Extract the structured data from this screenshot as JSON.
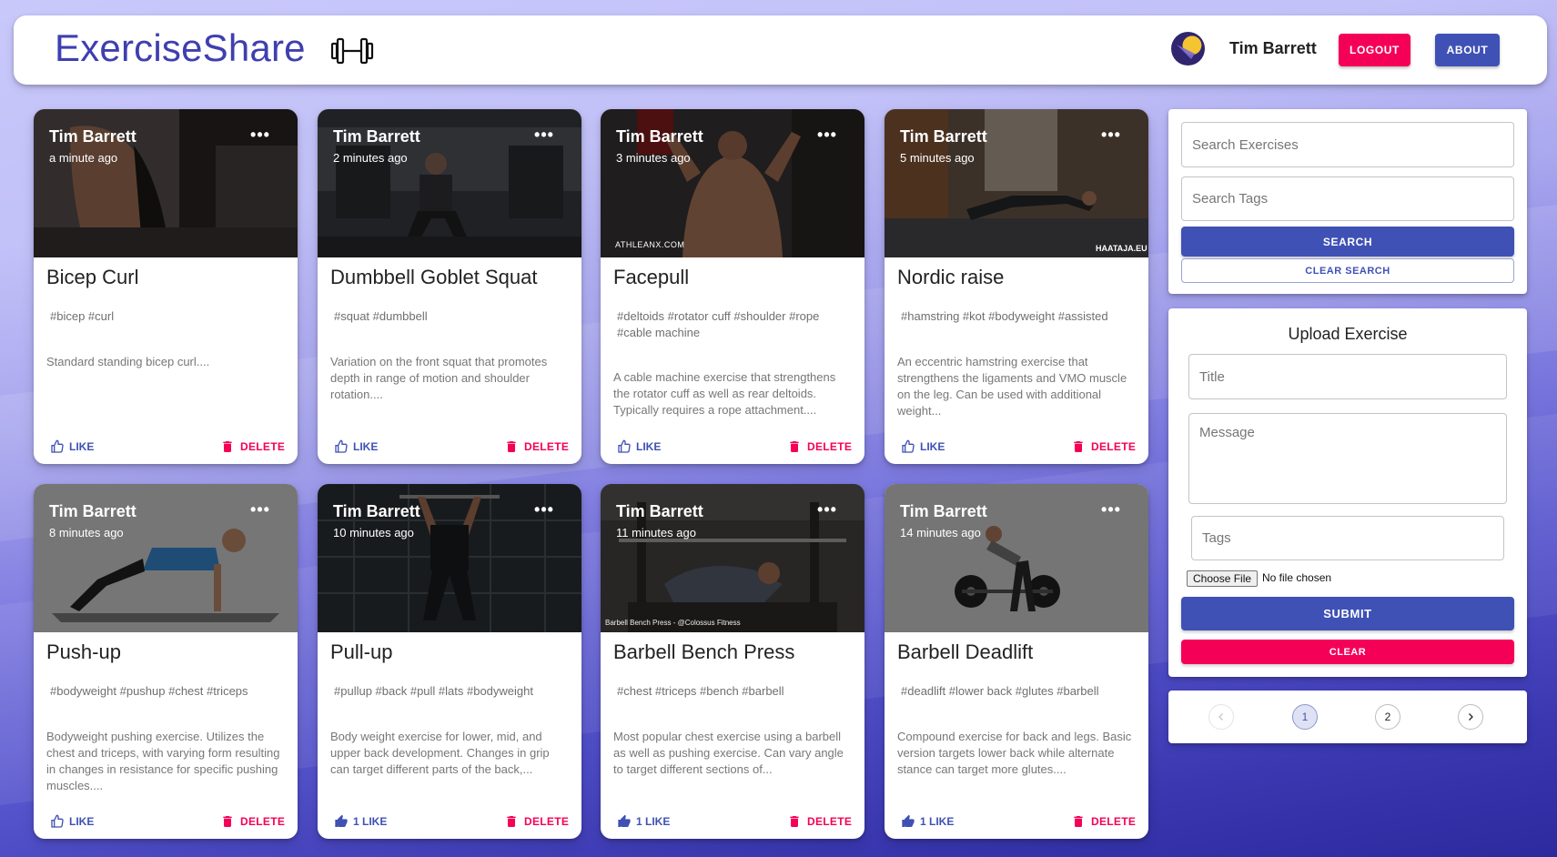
{
  "header": {
    "brand": "ExerciseShare",
    "brand_icon": "dumbbell-icon",
    "user_name": "Tim Barrett",
    "logout_label": "LOGOUT",
    "about_label": "ABOUT"
  },
  "colors": {
    "primary": "#3f51b5",
    "secondary": "#f50057",
    "brand_text": "#3f3fb0"
  },
  "posts": [
    {
      "author": "Tim Barrett",
      "time": "a minute ago",
      "title": "Bicep Curl",
      "tags": "#bicep #curl",
      "message": "Standard standing bicep curl....",
      "like_label": "LIKE",
      "like_filled": false,
      "delete_label": "DELETE"
    },
    {
      "author": "Tim Barrett",
      "time": "2 minutes ago",
      "title": "Dumbbell Goblet Squat",
      "tags": "#squat #dumbbell",
      "message": "Variation on the front squat that promotes depth in range of motion and shoulder rotation....",
      "like_label": "LIKE",
      "like_filled": false,
      "delete_label": "DELETE"
    },
    {
      "author": "Tim Barrett",
      "time": "3 minutes ago",
      "title": "Facepull",
      "tags": "#deltoids #rotator cuff #shoulder #rope #cable machine",
      "message": "A cable machine exercise that strengthens the rotator cuff as well as rear deltoids. Typically requires a rope attachment....",
      "like_label": "LIKE",
      "like_filled": false,
      "delete_label": "DELETE",
      "media_text": "ATHLEANX.COM"
    },
    {
      "author": "Tim Barrett",
      "time": "5 minutes ago",
      "title": "Nordic raise",
      "tags": "#hamstring #kot #bodyweight #assisted",
      "message": "An eccentric hamstring exercise that strengthens the ligaments and VMO muscle on the leg. Can be used with additional weight...",
      "like_label": "LIKE",
      "like_filled": false,
      "delete_label": "DELETE",
      "media_text": "HAATAJA.EU"
    },
    {
      "author": "Tim Barrett",
      "time": "8 minutes ago",
      "title": "Push-up",
      "tags": "#bodyweight #pushup #chest #triceps",
      "message": "Bodyweight pushing exercise. Utilizes the chest and triceps, with varying form resulting in changes in resistance for specific pushing muscles....",
      "like_label": "LIKE",
      "like_filled": false,
      "delete_label": "DELETE"
    },
    {
      "author": "Tim Barrett",
      "time": "10 minutes ago",
      "title": "Pull-up",
      "tags": "#pullup #back #pull #lats #bodyweight",
      "message": "Body weight exercise for lower, mid, and upper back development. Changes in grip can target different parts of the back,...",
      "like_label": "1 LIKE",
      "like_filled": true,
      "delete_label": "DELETE"
    },
    {
      "author": "Tim Barrett",
      "time": "11 minutes ago",
      "title": "Barbell Bench Press",
      "tags": "#chest #triceps #bench #barbell",
      "message": "Most popular chest exercise using a barbell as well as pushing exercise. Can vary angle to target different sections of...",
      "like_label": "1 LIKE",
      "like_filled": true,
      "delete_label": "DELETE",
      "media_text": "Barbell Bench Press - @Colossus Fitness"
    },
    {
      "author": "Tim Barrett",
      "time": "14 minutes ago",
      "title": "Barbell Deadlift",
      "tags": "#deadlift #lower back #glutes #barbell",
      "message": "Compound exercise for back and legs. Basic version targets lower back while alternate stance can target more glutes....",
      "like_label": "1 LIKE",
      "like_filled": true,
      "delete_label": "DELETE"
    }
  ],
  "search": {
    "exercises_placeholder": "Search Exercises",
    "tags_placeholder": "Search Tags",
    "search_label": "SEARCH",
    "clear_label": "CLEAR SEARCH"
  },
  "upload": {
    "heading": "Upload Exercise",
    "title_placeholder": "Title",
    "message_placeholder": "Message",
    "tags_placeholder": "Tags",
    "file_button": "Choose File",
    "file_status": "No file chosen",
    "submit_label": "SUBMIT",
    "clear_label": "CLEAR"
  },
  "pagination": {
    "pages": [
      "1",
      "2"
    ],
    "current": "1",
    "prev_icon": "chevron-left-icon",
    "next_icon": "chevron-right-icon"
  }
}
